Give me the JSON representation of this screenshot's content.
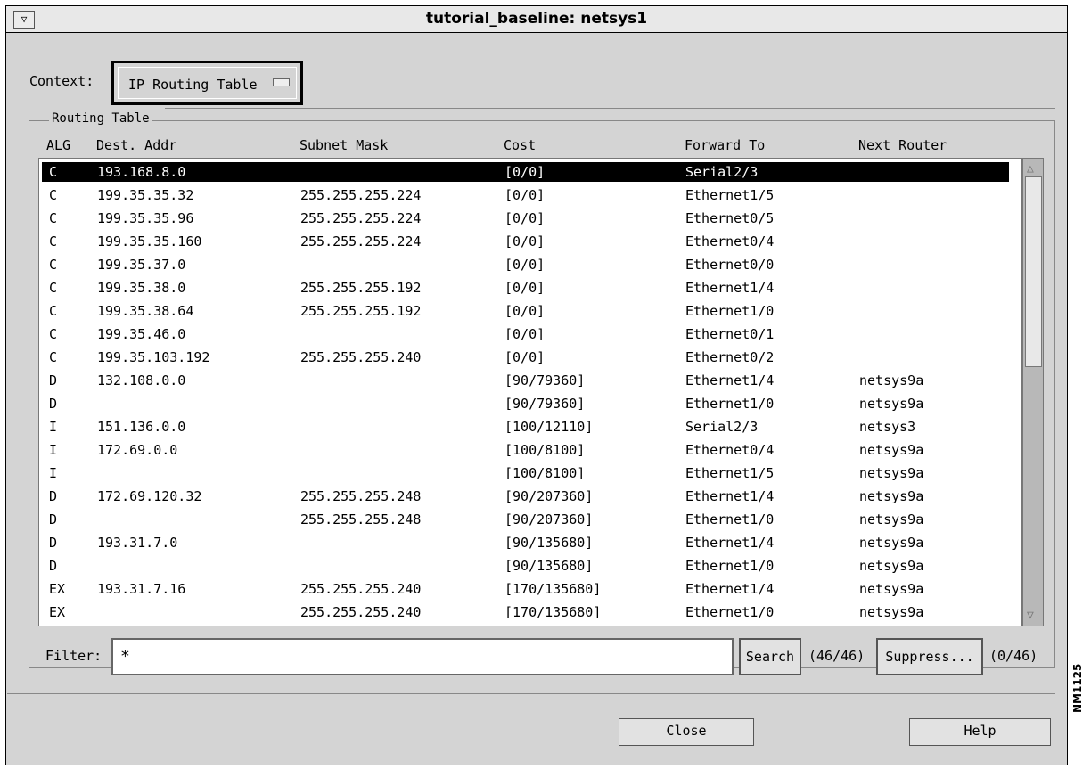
{
  "window": {
    "title": "tutorial_baseline: netsys1",
    "menu_icon": "window-menu-icon"
  },
  "context": {
    "label": "Context:",
    "value": "IP Routing Table"
  },
  "routing_table": {
    "group_label": "Routing Table",
    "columns": [
      "ALG",
      "Dest. Addr",
      "Subnet Mask",
      "Cost",
      "Forward To",
      "Next Router"
    ],
    "rows": [
      {
        "alg": "C",
        "dest": "193.168.8.0",
        "mask": "",
        "cost": "[0/0]",
        "forward": "Serial2/3",
        "next": ""
      },
      {
        "alg": "C",
        "dest": "199.35.35.32",
        "mask": "255.255.255.224",
        "cost": "[0/0]",
        "forward": "Ethernet1/5",
        "next": ""
      },
      {
        "alg": "C",
        "dest": "199.35.35.96",
        "mask": "255.255.255.224",
        "cost": "[0/0]",
        "forward": "Ethernet0/5",
        "next": ""
      },
      {
        "alg": "C",
        "dest": "199.35.35.160",
        "mask": "255.255.255.224",
        "cost": "[0/0]",
        "forward": "Ethernet0/4",
        "next": ""
      },
      {
        "alg": "C",
        "dest": "199.35.37.0",
        "mask": "",
        "cost": "[0/0]",
        "forward": "Ethernet0/0",
        "next": ""
      },
      {
        "alg": "C",
        "dest": "199.35.38.0",
        "mask": "255.255.255.192",
        "cost": "[0/0]",
        "forward": "Ethernet1/4",
        "next": ""
      },
      {
        "alg": "C",
        "dest": "199.35.38.64",
        "mask": "255.255.255.192",
        "cost": "[0/0]",
        "forward": "Ethernet1/0",
        "next": ""
      },
      {
        "alg": "C",
        "dest": "199.35.46.0",
        "mask": "",
        "cost": "[0/0]",
        "forward": "Ethernet0/1",
        "next": ""
      },
      {
        "alg": "C",
        "dest": "199.35.103.192",
        "mask": "255.255.255.240",
        "cost": "[0/0]",
        "forward": "Ethernet0/2",
        "next": ""
      },
      {
        "alg": "D",
        "dest": "132.108.0.0",
        "mask": "",
        "cost": "[90/79360]",
        "forward": "Ethernet1/4",
        "next": "netsys9a"
      },
      {
        "alg": "D",
        "dest": "",
        "mask": "",
        "cost": "[90/79360]",
        "forward": "Ethernet1/0",
        "next": "netsys9a"
      },
      {
        "alg": "I",
        "dest": "151.136.0.0",
        "mask": "",
        "cost": "[100/12110]",
        "forward": "Serial2/3",
        "next": "netsys3"
      },
      {
        "alg": "I",
        "dest": "172.69.0.0",
        "mask": "",
        "cost": "[100/8100]",
        "forward": "Ethernet0/4",
        "next": "netsys9a"
      },
      {
        "alg": "I",
        "dest": "",
        "mask": "",
        "cost": "[100/8100]",
        "forward": "Ethernet1/5",
        "next": "netsys9a"
      },
      {
        "alg": "D",
        "dest": "172.69.120.32",
        "mask": "255.255.255.248",
        "cost": "[90/207360]",
        "forward": "Ethernet1/4",
        "next": "netsys9a"
      },
      {
        "alg": "D",
        "dest": "",
        "mask": "255.255.255.248",
        "cost": "[90/207360]",
        "forward": "Ethernet1/0",
        "next": "netsys9a"
      },
      {
        "alg": "D",
        "dest": "193.31.7.0",
        "mask": "",
        "cost": "[90/135680]",
        "forward": "Ethernet1/4",
        "next": "netsys9a"
      },
      {
        "alg": "D",
        "dest": "",
        "mask": "",
        "cost": "[90/135680]",
        "forward": "Ethernet1/0",
        "next": "netsys9a"
      },
      {
        "alg": "EX",
        "dest": "193.31.7.16",
        "mask": "255.255.255.240",
        "cost": "[170/135680]",
        "forward": "Ethernet1/4",
        "next": "netsys9a"
      },
      {
        "alg": "EX",
        "dest": "",
        "mask": "255.255.255.240",
        "cost": "[170/135680]",
        "forward": "Ethernet1/0",
        "next": "netsys9a"
      }
    ],
    "selected_row": 0
  },
  "filter": {
    "label": "Filter:",
    "value": "*",
    "search_label": "Search",
    "search_count": "(46/46)",
    "suppress_label": "Suppress...",
    "suppress_count": "(0/46)"
  },
  "footer": {
    "close_label": "Close",
    "help_label": "Help"
  },
  "figure_id": "NM1125",
  "colors": {
    "window_bg": "#d4d4d4",
    "selection_bg": "#000000",
    "selection_fg": "#ffffff"
  }
}
